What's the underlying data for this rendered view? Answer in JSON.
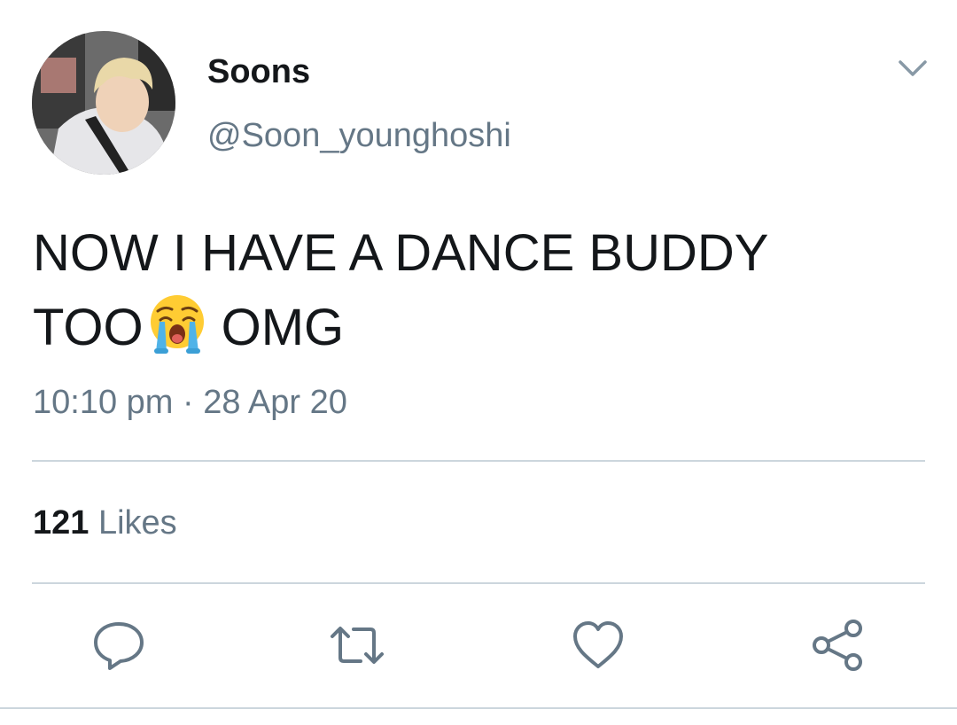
{
  "tweet": {
    "display_name": "Soons",
    "handle": "@Soon_younghoshi",
    "text_line1": "NOW I HAVE A DANCE BUDDY",
    "text_line2_before": "TOO",
    "text_line2_after": "OMG",
    "emoji": "loudly-crying-face",
    "timestamp": "10:10 pm · 28 Apr 20",
    "likes_count": "121",
    "likes_label": "Likes"
  },
  "icons": {
    "menu": "chevron-down-icon",
    "reply": "reply-icon",
    "retweet": "retweet-icon",
    "like": "heart-icon",
    "share": "share-icon"
  },
  "colors": {
    "text_primary": "#14171a",
    "text_secondary": "#657786",
    "divider": "#ccd6dd",
    "action_icon": "#657786"
  }
}
